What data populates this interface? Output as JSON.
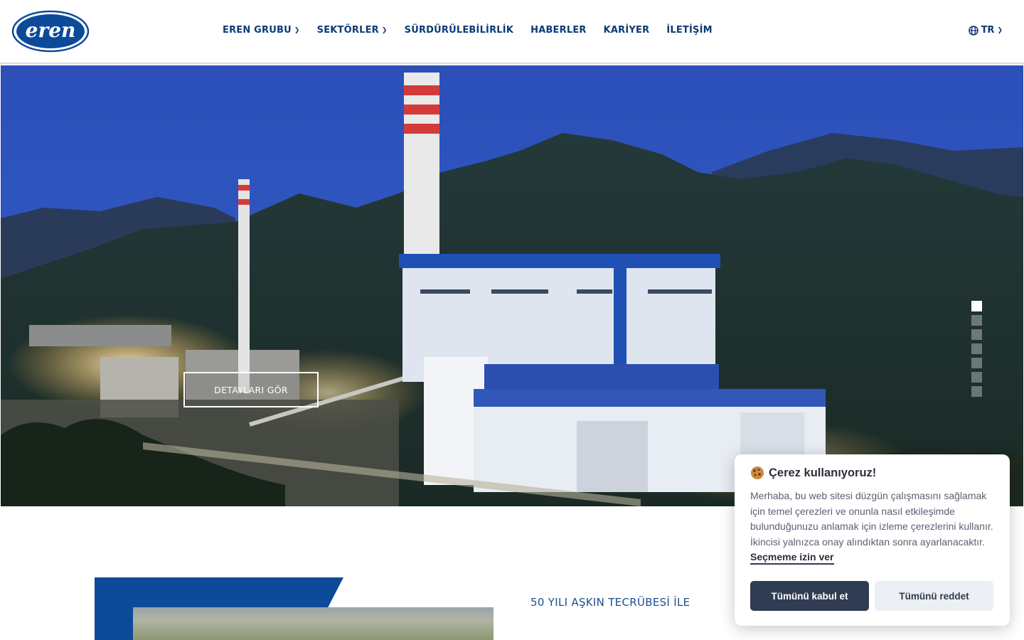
{
  "brand": {
    "logo_text": "eren",
    "color": "#0d4a9a"
  },
  "nav": {
    "items": [
      {
        "label": "EREN GRUBU",
        "has_dropdown": true
      },
      {
        "label": "SEKTÖRLER",
        "has_dropdown": true
      },
      {
        "label": "SÜRDÜRÜLEBİLİRLİK",
        "has_dropdown": false
      },
      {
        "label": "HABERLER",
        "has_dropdown": false
      },
      {
        "label": "KARİYER",
        "has_dropdown": false
      },
      {
        "label": "İLETİŞİM",
        "has_dropdown": false
      }
    ],
    "language": {
      "label": "TR",
      "icon": "globe-icon"
    }
  },
  "hero": {
    "cta_label": "DETAYLARI GÖR",
    "slides_total": 7,
    "active_slide": 1
  },
  "intro": {
    "eyebrow": "50 YILI AŞKIN TECRÜBESİ İLE"
  },
  "cookie": {
    "icon": "cookie-icon",
    "title": "Çerez kullanıyoruz!",
    "text": "Merhaba, bu web sitesi düzgün çalışmasını sağlamak için temel çerezleri ve onunla nasıl etkileşimde bulunduğunuzu anlamak için izleme çerezlerini kullanır. İkincisi yalnızca onay alındıktan sonra ayarlanacaktır.",
    "link_label": "Seçmeme izin ver",
    "accept_label": "Tümünü kabul et",
    "reject_label": "Tümünü reddet"
  },
  "colors": {
    "nav_text": "#0d3a78",
    "accent": "#0d4a9a",
    "cookie_button": "#2f3c52"
  }
}
